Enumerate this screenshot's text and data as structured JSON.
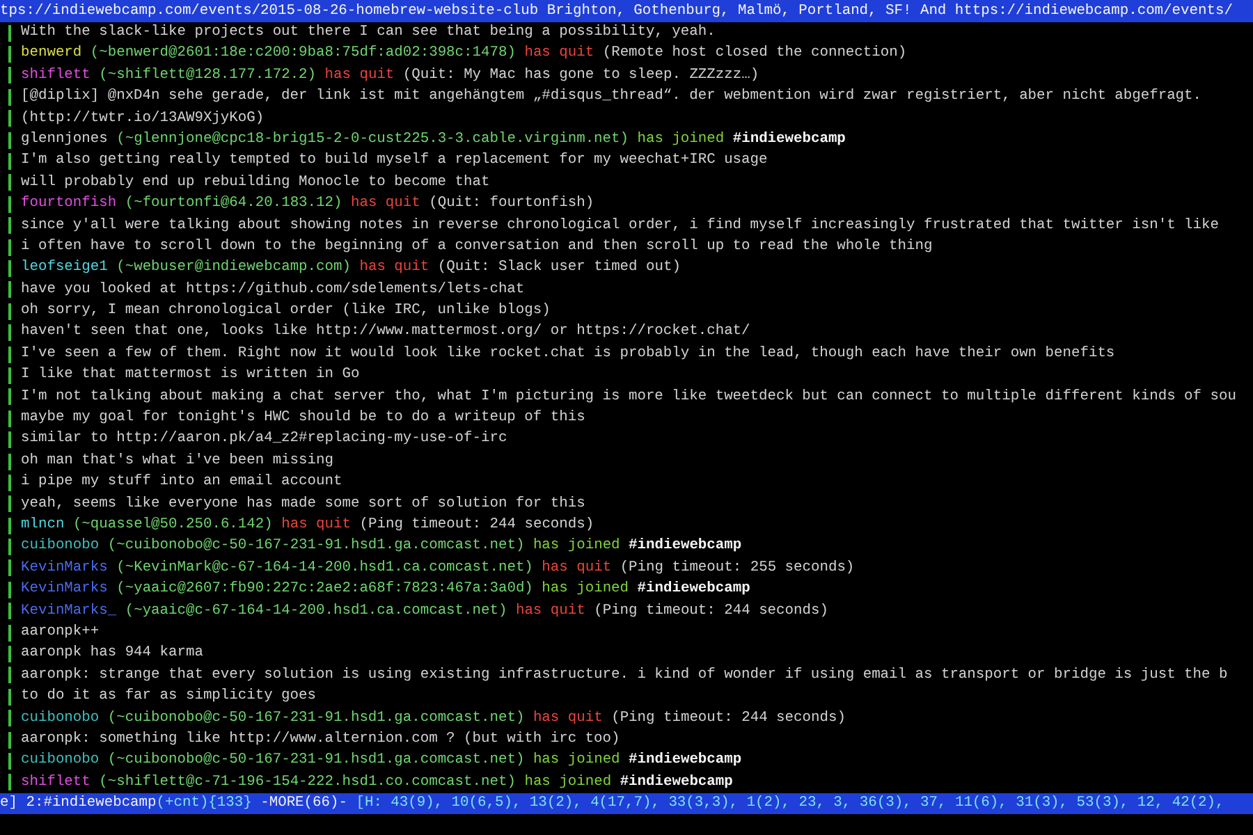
{
  "topic": "tps://indiewebcamp.com/events/2015-08-26-homebrew-website-club Brighton, Gothenburg, Malmö, Portland, SF! And https://indiewebcamp.com/events/",
  "lines": [
    {
      "kind": "message",
      "text": "With the slack-like projects out there I can see that being a possibility, yeah."
    },
    {
      "kind": "quit",
      "nick": "benwerd",
      "color": "#dede4a",
      "host": "(~benwerd@2601:18e:c200:9ba8:75df:ad02:398c:1478)",
      "action": "has quit",
      "reason": "(Remote host closed the connection)"
    },
    {
      "kind": "quit",
      "nick": "shiflett",
      "color": "#e04fe0",
      "host": "(~shiflett@128.177.172.2)",
      "action": "has quit",
      "reason": "(Quit: My Mac has gone to sleep. ZZZzzz…)"
    },
    {
      "kind": "message",
      "text": "[@diplix] @nxD4n sehe gerade, der link ist mit angehängtem „#disqus_thread“. der webmention wird zwar registriert, aber nicht abgefragt."
    },
    {
      "kind": "message",
      "text": "(http://twtr.io/13AW9XjyKoG)"
    },
    {
      "kind": "join",
      "nick": "glennjones",
      "color": "#d4d4d4",
      "host": "(~glennjone@cpc18-brig15-2-0-cust225.3-3.cable.virginm.net)",
      "action": "has joined",
      "channel": "#indiewebcamp"
    },
    {
      "kind": "message",
      "text": "I'm also getting really tempted to build myself a replacement for my weechat+IRC usage"
    },
    {
      "kind": "message",
      "text": "will probably end up rebuilding Monocle to become that"
    },
    {
      "kind": "quit",
      "nick": "fourtonfish",
      "color": "#e04fe0",
      "host": "(~fourtonfi@64.20.183.12)",
      "action": "has quit",
      "reason": "(Quit: fourtonfish)"
    },
    {
      "kind": "message",
      "text": "since y'all were talking about showing notes in reverse chronological order, i find myself increasingly frustrated that twitter isn't like"
    },
    {
      "kind": "message",
      "text": "i often have to scroll down to the beginning of a conversation and then scroll up to read the whole thing"
    },
    {
      "kind": "quit",
      "nick": "leofseige1",
      "color": "#4fd8e0",
      "host": "(~webuser@indiewebcamp.com)",
      "action": "has quit",
      "reason": "(Quit: Slack user timed out)"
    },
    {
      "kind": "message",
      "text": "have you looked at https://github.com/sdelements/lets-chat"
    },
    {
      "kind": "message",
      "text": "oh sorry, I mean chronological order (like IRC, unlike blogs)"
    },
    {
      "kind": "message",
      "text": "haven't seen that one, looks like http://www.mattermost.org/ or https://rocket.chat/"
    },
    {
      "kind": "message",
      "text": "I've seen a few of them. Right now it would look like rocket.chat is probably in the lead, though each have their own benefits"
    },
    {
      "kind": "message",
      "text": "I like that mattermost is written in Go"
    },
    {
      "kind": "message",
      "text": "I'm not talking about making a chat server tho, what I'm picturing is more like tweetdeck but can connect to multiple different kinds of sou"
    },
    {
      "kind": "message",
      "text": "maybe my goal for tonight's HWC should be to do a writeup of this"
    },
    {
      "kind": "message",
      "text": "similar to http://aaron.pk/a4_z2#replacing-my-use-of-irc"
    },
    {
      "kind": "message",
      "text": "oh man that's what i've been missing"
    },
    {
      "kind": "message",
      "text": "i pipe my stuff into an email account"
    },
    {
      "kind": "message",
      "text": "yeah, seems like everyone has made some sort of solution for this"
    },
    {
      "kind": "quit",
      "nick": "mlncn",
      "color": "#4fd8e0",
      "host": "(~quassel@50.250.6.142)",
      "action": "has quit",
      "reason": "(Ping timeout: 244 seconds)"
    },
    {
      "kind": "join",
      "nick": "cuibonobo",
      "color": "#3fbfbf",
      "host": "(~cuibonobo@c-50-167-231-91.hsd1.ga.comcast.net)",
      "action": "has joined",
      "channel": "#indiewebcamp"
    },
    {
      "kind": "quit",
      "nick": "KevinMarks",
      "color": "#4a6cf0",
      "host": "(~KevinMark@c-67-164-14-200.hsd1.ca.comcast.net)",
      "action": "has quit",
      "reason": "(Ping timeout: 255 seconds)"
    },
    {
      "kind": "join",
      "nick": "KevinMarks",
      "color": "#4a6cf0",
      "host": "(~yaaic@2607:fb90:227c:2ae2:a68f:7823:467a:3a0d)",
      "action": "has joined",
      "channel": "#indiewebcamp"
    },
    {
      "kind": "quit",
      "nick": "KevinMarks_",
      "color": "#4a6cf0",
      "host": "(~yaaic@c-67-164-14-200.hsd1.ca.comcast.net)",
      "action": "has quit",
      "reason": "(Ping timeout: 244 seconds)"
    },
    {
      "kind": "message",
      "text": "aaronpk++"
    },
    {
      "kind": "message",
      "text": "aaronpk has 944 karma"
    },
    {
      "kind": "message",
      "text": "aaronpk: strange that every solution is using existing infrastructure. i kind of wonder if using email as transport or bridge is just the b"
    },
    {
      "kind": "message",
      "text": "to do it as far as simplicity goes"
    },
    {
      "kind": "quit",
      "nick": "cuibonobo",
      "color": "#3fbfbf",
      "host": "(~cuibonobo@c-50-167-231-91.hsd1.ga.comcast.net)",
      "action": "has quit",
      "reason": "(Ping timeout: 244 seconds)"
    },
    {
      "kind": "message",
      "text": "aaronpk: something like http://www.alternion.com ? (but with irc too)"
    },
    {
      "kind": "join",
      "nick": "cuibonobo",
      "color": "#3fbfbf",
      "host": "(~cuibonobo@c-50-167-231-91.hsd1.ga.comcast.net)",
      "action": "has joined",
      "channel": "#indiewebcamp"
    },
    {
      "kind": "join",
      "nick": "shiflett",
      "color": "#e04fe0",
      "host": "(~shiflett@c-71-196-154-222.hsd1.co.comcast.net)",
      "action": "has joined",
      "channel": "#indiewebcamp"
    }
  ],
  "status_bar": {
    "window_tail": "e]",
    "buffer": "2:#indiewebcamp",
    "buffer_info": "(+cnt){133}",
    "more": "-MORE(66)-",
    "hotlist": "[H: 43(9), 10(6,5), 13(2), 4(17,7), 33(3,3), 1(2), 23, 3, 36(3), 37, 11(6), 31(3), 53(3), 12, 42(2),"
  }
}
